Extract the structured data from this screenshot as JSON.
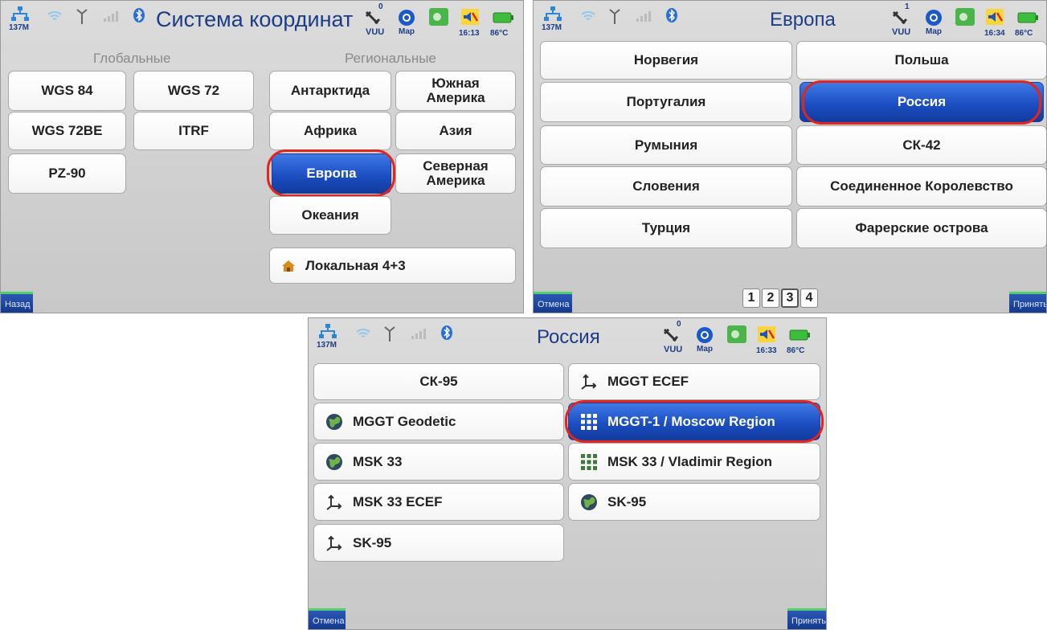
{
  "status": {
    "net_label": "137M",
    "sat_count_1": "0",
    "sat_count_2": "1",
    "sat_count_3": "0",
    "vuu": "VUU",
    "map": "Map",
    "time_1": "16:13",
    "time_2": "16:34",
    "time_3": "16:33",
    "temp": "86°C"
  },
  "screen1": {
    "title": "Система координат",
    "global_label": "Глобальные",
    "regional_label": "Региональные",
    "global_items": [
      "WGS 84",
      "WGS 72",
      "WGS 72BE",
      "ITRF",
      "PZ-90"
    ],
    "regional_items": [
      "Антарктида",
      "Южная Америка",
      "Африка",
      "Азия",
      "Европа",
      "Северная Америка",
      "Океания"
    ],
    "local_label": "Локальная 4+3",
    "back_label": "Назад"
  },
  "screen2": {
    "title": "Европа",
    "items": [
      "Норвегия",
      "Польша",
      "Португалия",
      "Россия",
      "Румыния",
      "СК-42",
      "Словения",
      "Соединенное Королевство",
      "Турция",
      "Фарерские острова"
    ],
    "pages": [
      "1",
      "2",
      "3",
      "4"
    ],
    "active_page": "3",
    "cancel_label": "Отмена",
    "accept_label": "Принять"
  },
  "screen3": {
    "title": "Россия",
    "items": [
      "СК-95",
      "MGGT ECEF",
      "MGGT Geodetic",
      "MGGT-1 / Moscow Region",
      "MSK 33",
      "MSK 33 / Vladimir Region",
      "MSK 33 ECEF",
      "SK-95",
      "SK-95"
    ],
    "icons": [
      "",
      "axes-icon",
      "globe-icon",
      "grid-icon",
      "globe-icon",
      "grid-icon",
      "axes-icon",
      "globe-icon",
      "axes-icon"
    ],
    "cancel_label": "Отмена",
    "accept_label": "Принять"
  },
  "colors": {
    "accent": "#1c4fc3",
    "highlight": "#e0261d",
    "title": "#1c3d86"
  }
}
